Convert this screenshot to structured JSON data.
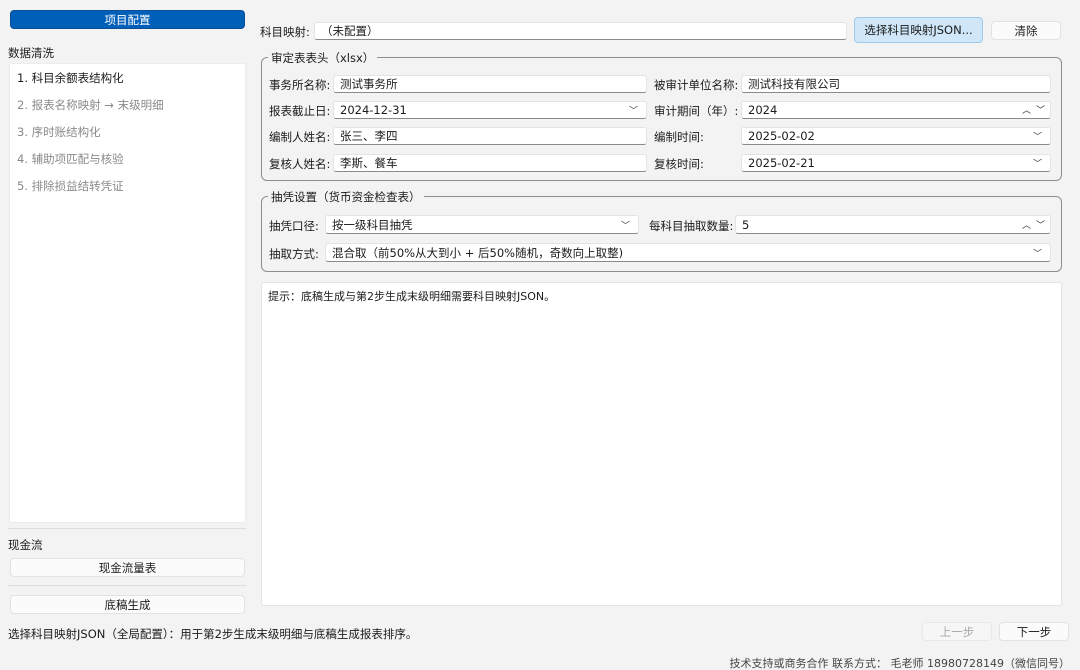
{
  "sidebar": {
    "project_config_label": "项目配置",
    "data_cleaning_label": "数据清洗",
    "steps": [
      "1. 科目余额表结构化",
      "2. 报表名称映射 → 末级明细",
      "3. 序时账结构化",
      "4. 辅助项匹配与核验",
      "5. 排除损益结转凭证"
    ],
    "active_step": 0,
    "cashflow_label": "现金流",
    "cashflow_statement_button": "现金流量表",
    "draft_generate_button": "底稿生成"
  },
  "mapping": {
    "label": "科目映射:",
    "value": "（未配置）",
    "choose_button": "选择科目映射JSON...",
    "clear_button": "清除"
  },
  "header_group": {
    "title": "审定表表头（xlsx）",
    "firm_label": "事务所名称:",
    "firm_value": "测试事务所",
    "auditee_label": "被审计单位名称:",
    "auditee_value": "测试科技有限公司",
    "report_date_label": "报表截止日:",
    "report_date_value": "2024-12-31",
    "period_label": "审计期间（年）:",
    "period_value": "2024",
    "preparer_label": "编制人姓名:",
    "preparer_value": "张三、李四",
    "prepared_time_label": "编制时间:",
    "prepared_time_value": "2025-02-02",
    "reviewer_label": "复核人姓名:",
    "reviewer_value": "李斯、餐车",
    "review_time_label": "复核时间:",
    "review_time_value": "2025-02-21"
  },
  "sampling_group": {
    "title": "抽凭设置（货币资金检查表）",
    "basis_label": "抽凭口径:",
    "basis_value": "按一级科目抽凭",
    "count_label": "每科目抽取数量:",
    "count_value": "5",
    "method_label": "抽取方式:",
    "method_value": "混合取（前50%从大到小 + 后50%随机，奇数向上取整)"
  },
  "hint_text": "提示：底稿生成与第2步生成末级明细需要科目映射JSON。",
  "status": {
    "message": "选择科目映射JSON（全局配置）：用于第2步生成末级明细与底稿生成报表排序。",
    "prev_button": "上一步",
    "next_button": "下一步",
    "footer": "技术支持或商务合作 联系方式： 毛老师 18980728149（微信同号）"
  }
}
